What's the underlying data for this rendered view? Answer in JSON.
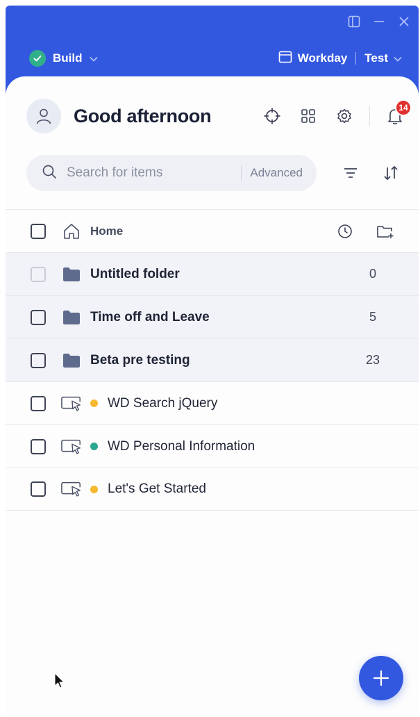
{
  "topbar": {
    "mode_label": "Build",
    "env_app": "Workday",
    "env_stage": "Test"
  },
  "header": {
    "greeting": "Good afternoon",
    "notification_count": "14"
  },
  "search": {
    "placeholder": "Search for items",
    "advanced_label": "Advanced"
  },
  "list": {
    "home_label": "Home",
    "folders": [
      {
        "name": "Untitled folder",
        "count": "0"
      },
      {
        "name": "Time off and Leave",
        "count": "5"
      },
      {
        "name": "Beta pre testing",
        "count": "23"
      }
    ],
    "items": [
      {
        "name": "WD Search jQuery",
        "status_color": "#f5b82e"
      },
      {
        "name": "WD Personal Information",
        "status_color": "#2ba58e"
      },
      {
        "name": "Let's Get Started",
        "status_color": "#f5b82e"
      }
    ]
  },
  "colors": {
    "brand": "#3358e0",
    "success": "#2fb08a",
    "badge": "#e02f2f"
  }
}
